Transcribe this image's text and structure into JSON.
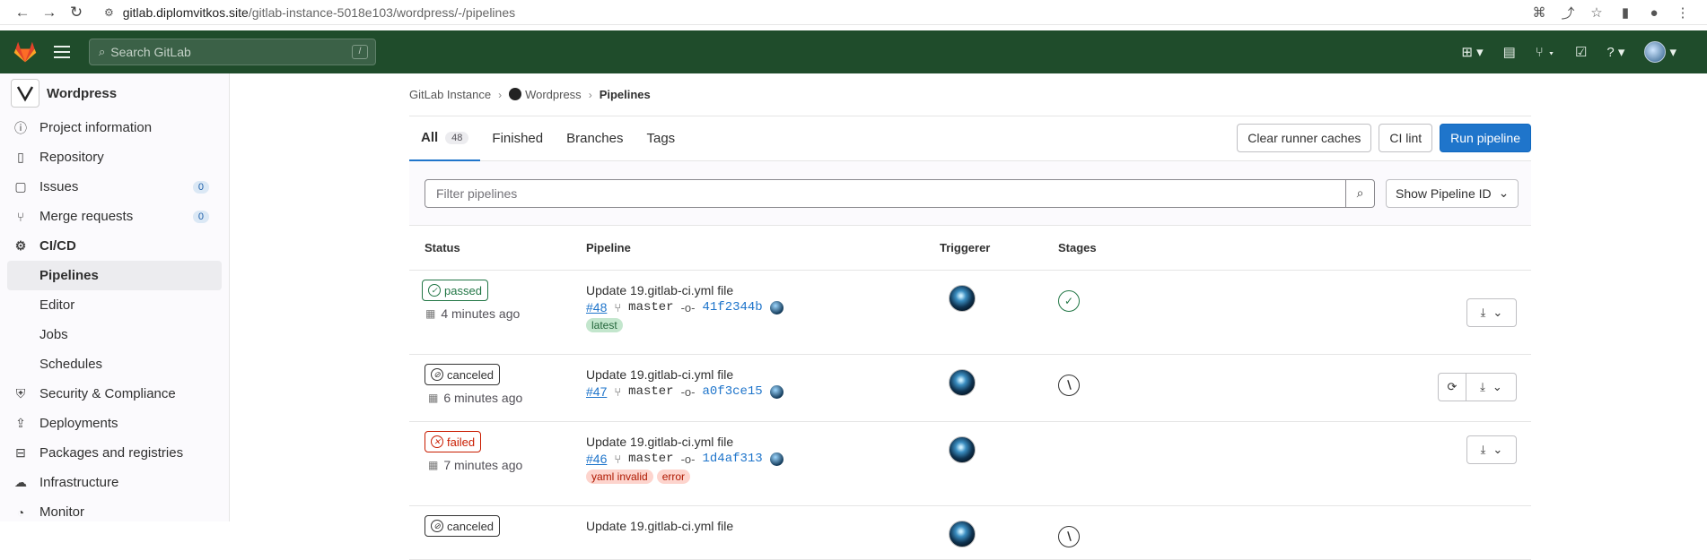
{
  "browser": {
    "url_host": "gitlab.diplomvitkos.site",
    "url_path": "/gitlab-instance-5018e103/wordpress/-/pipelines"
  },
  "topbar": {
    "search_placeholder": "Search GitLab",
    "search_shortcut": "/"
  },
  "sidebar": {
    "project_name": "Wordpress",
    "items": [
      {
        "label": "Project information",
        "icon": "info-icon"
      },
      {
        "label": "Repository",
        "icon": "doc-icon"
      },
      {
        "label": "Issues",
        "icon": "issues-icon",
        "count": "0"
      },
      {
        "label": "Merge requests",
        "icon": "merge-request-icon",
        "count": "0"
      },
      {
        "label": "CI/CD",
        "icon": "rocket-icon"
      }
    ],
    "cicd_sub": [
      "Pipelines",
      "Editor",
      "Jobs",
      "Schedules"
    ],
    "items_after": [
      {
        "label": "Security & Compliance",
        "icon": "shield-icon"
      },
      {
        "label": "Deployments",
        "icon": "deploy-icon"
      },
      {
        "label": "Packages and registries",
        "icon": "package-icon"
      },
      {
        "label": "Infrastructure",
        "icon": "cloud-icon"
      },
      {
        "label": "Monitor",
        "icon": "monitor-icon"
      }
    ]
  },
  "breadcrumb": {
    "root": "GitLab Instance",
    "project": "Wordpress",
    "current": "Pipelines"
  },
  "tabs": {
    "all": "All",
    "all_count": "48",
    "finished": "Finished",
    "branches": "Branches",
    "tags": "Tags"
  },
  "actions": {
    "clear_caches": "Clear runner caches",
    "ci_lint": "CI lint",
    "run_pipeline": "Run pipeline"
  },
  "filter": {
    "placeholder": "Filter pipelines",
    "show_id": "Show Pipeline ID"
  },
  "table": {
    "headers": {
      "status": "Status",
      "pipeline": "Pipeline",
      "triggerer": "Triggerer",
      "stages": "Stages"
    },
    "rows": [
      {
        "status": "passed",
        "time": "4 minutes ago",
        "title": "Update 19.gitlab-ci.yml file",
        "id": "#48",
        "branch": "master",
        "commit": "41f2344b",
        "labels": [
          "latest"
        ]
      },
      {
        "status": "canceled",
        "time": "6 minutes ago",
        "title": "Update 19.gitlab-ci.yml file",
        "id": "#47",
        "branch": "master",
        "commit": "a0f3ce15",
        "labels": []
      },
      {
        "status": "failed",
        "time": "7 minutes ago",
        "title": "Update 19.gitlab-ci.yml file",
        "id": "#46",
        "branch": "master",
        "commit": "1d4af313",
        "labels": [
          "yaml invalid",
          "error"
        ]
      },
      {
        "status": "canceled",
        "title": "Update 19.gitlab-ci.yml file"
      }
    ]
  },
  "colors": {
    "topbar": "#1f4c2b",
    "primary": "#1f75cb",
    "passed": "#217645",
    "failed": "#c91c00"
  }
}
